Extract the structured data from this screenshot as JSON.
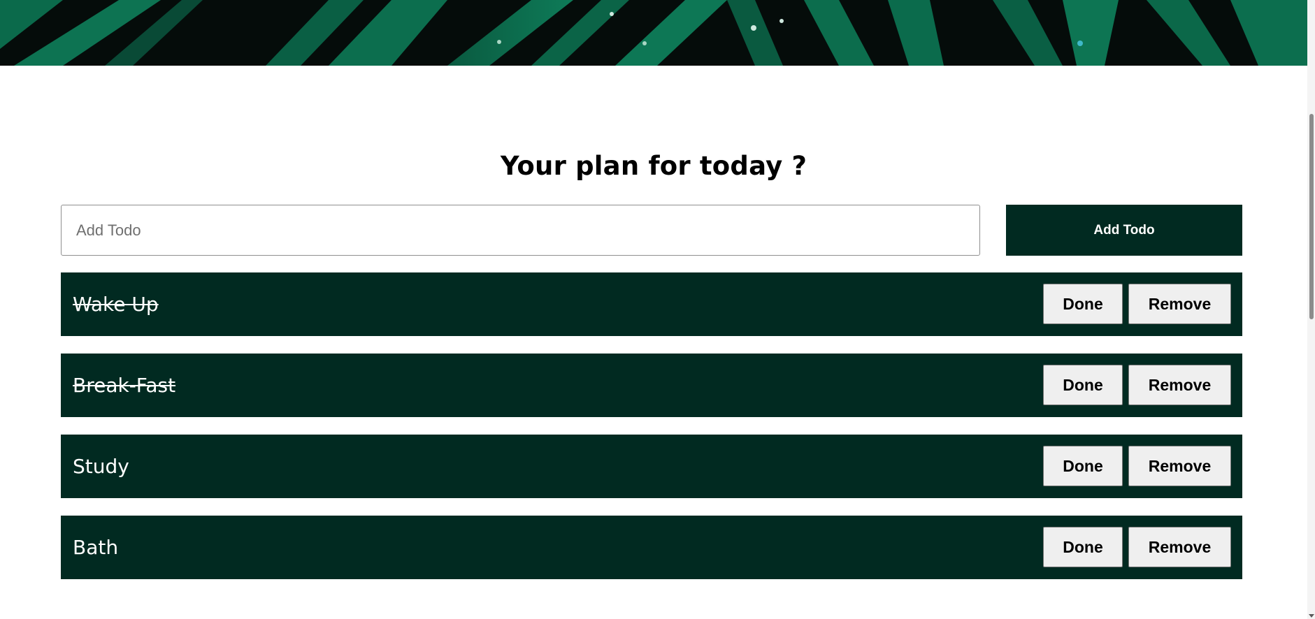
{
  "hero": {
    "icon": "palm-leaves-image"
  },
  "heading": {
    "title": "Your plan for today ?"
  },
  "form": {
    "input_placeholder": "Add Todo",
    "input_value": "",
    "add_button_label": "Add Todo"
  },
  "todos": [
    {
      "text": "Wake Up",
      "completed": true,
      "done_label": "Done",
      "remove_label": "Remove"
    },
    {
      "text": "Break-Fast",
      "completed": true,
      "done_label": "Done",
      "remove_label": "Remove"
    },
    {
      "text": "Study",
      "completed": false,
      "done_label": "Done",
      "remove_label": "Remove"
    },
    {
      "text": "Bath",
      "completed": false,
      "done_label": "Done",
      "remove_label": "Remove"
    }
  ],
  "colors": {
    "accent": "#012a21",
    "button_bg": "#efefef",
    "text_on_accent": "#ffffff"
  }
}
